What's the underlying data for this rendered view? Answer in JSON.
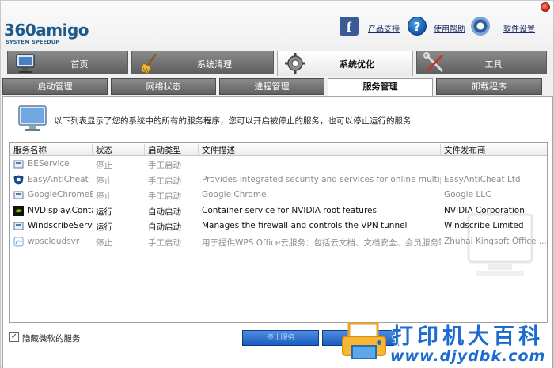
{
  "logo": {
    "main": "360amigo",
    "sub": "SYSTEM SPEEDUP"
  },
  "toplinks": [
    {
      "icon": "facebook-icon",
      "label": "产品支持"
    },
    {
      "icon": "help-icon",
      "label": "使用帮助"
    },
    {
      "icon": "gear-icon",
      "label": "软件设置"
    }
  ],
  "main_tabs": [
    {
      "label": "首页",
      "icon": "computer-icon"
    },
    {
      "label": "系统清理",
      "icon": "broom-icon"
    },
    {
      "label": "系统优化",
      "icon": "gear-icon"
    },
    {
      "label": "工具",
      "icon": "tools-icon"
    }
  ],
  "sub_tabs": [
    "启动管理",
    "网络状态",
    "进程管理",
    "服务管理",
    "卸载程序"
  ],
  "info_text": "以下列表显示了您的系统中的所有的服务程序，您可以开启被停止的服务，也可以停止运行的服务",
  "table": {
    "headers": [
      "服务名称",
      "状态",
      "启动类型",
      "文件描述",
      "文件发布商"
    ],
    "rows": [
      {
        "name": "BEService",
        "status": "停止",
        "type": "手工启动",
        "desc": "",
        "publisher": "",
        "state": "disabled",
        "icon": "service-icon"
      },
      {
        "name": "EasyAntiCheat",
        "status": "停止",
        "type": "手工启动",
        "desc": "Provides integrated security and services for online multiplayer gam...",
        "publisher": "EasyAntiCheat Ltd",
        "state": "disabled",
        "icon": "shield-icon"
      },
      {
        "name": "GoogleChromeE...",
        "status": "停止",
        "type": "手工启动",
        "desc": "Google Chrome",
        "publisher": "Google LLC",
        "state": "disabled",
        "icon": "service-icon"
      },
      {
        "name": "NVDisplay.Conta...",
        "status": "运行",
        "type": "自动启动",
        "desc": "Container service for NVIDIA root features",
        "publisher": "NVIDIA Corporation",
        "state": "enabled",
        "icon": "nvidia-icon"
      },
      {
        "name": "WindscribeService",
        "status": "运行",
        "type": "自动启动",
        "desc": "Manages the firewall and controls the VPN tunnel",
        "publisher": "Windscribe Limited",
        "state": "enabled",
        "icon": "service-icon"
      },
      {
        "name": "wpscloudsvr",
        "status": "停止",
        "type": "手工启动",
        "desc": "用于提供WPS Office云服务：包括云文档、文档安全、会员服务等多...",
        "publisher": "Zhuhai Kingsoft Office ...",
        "state": "disabled",
        "icon": "wps-icon"
      }
    ]
  },
  "hide_ms": {
    "label": "隐藏微软的服务",
    "checked": "✓"
  },
  "buttons": {
    "stop": "停止服务",
    "start": "开启服务"
  },
  "watermark": {
    "title": "打印机大百科",
    "url": "www.djydbk.com"
  },
  "colors": {
    "tab_dark": "#6a6a6a",
    "accent_blue": "#1b6bd0",
    "link": "#1a2a6a"
  }
}
